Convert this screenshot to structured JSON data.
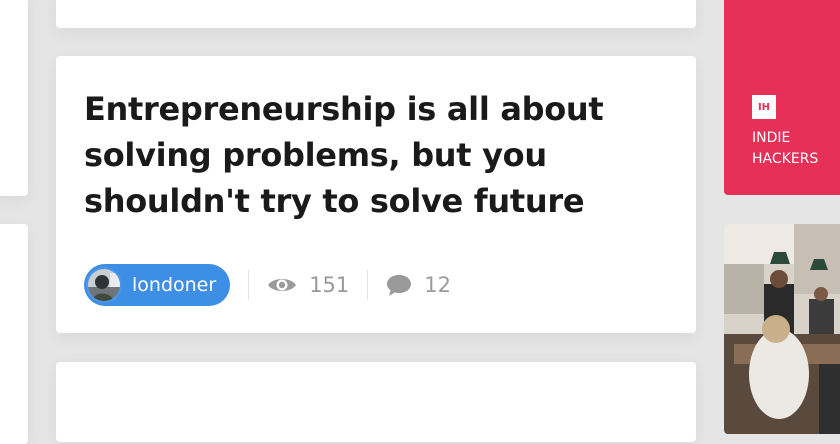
{
  "post": {
    "title": "Entrepreneurship is all about solving problems, but you shouldn't try to solve future",
    "author": "londoner",
    "views": "151",
    "comments": "12"
  },
  "sidebar_ad": {
    "logo": "IH",
    "line1": "INDIE",
    "line2": "HACKERS",
    "color": "#e63058"
  },
  "icons": {
    "views": "eye-icon",
    "comments": "comment-bubble-icon"
  },
  "colors": {
    "author_pill": "#3d8fe6",
    "muted_text": "#9a9a9a",
    "background": "#e5e5e5"
  }
}
